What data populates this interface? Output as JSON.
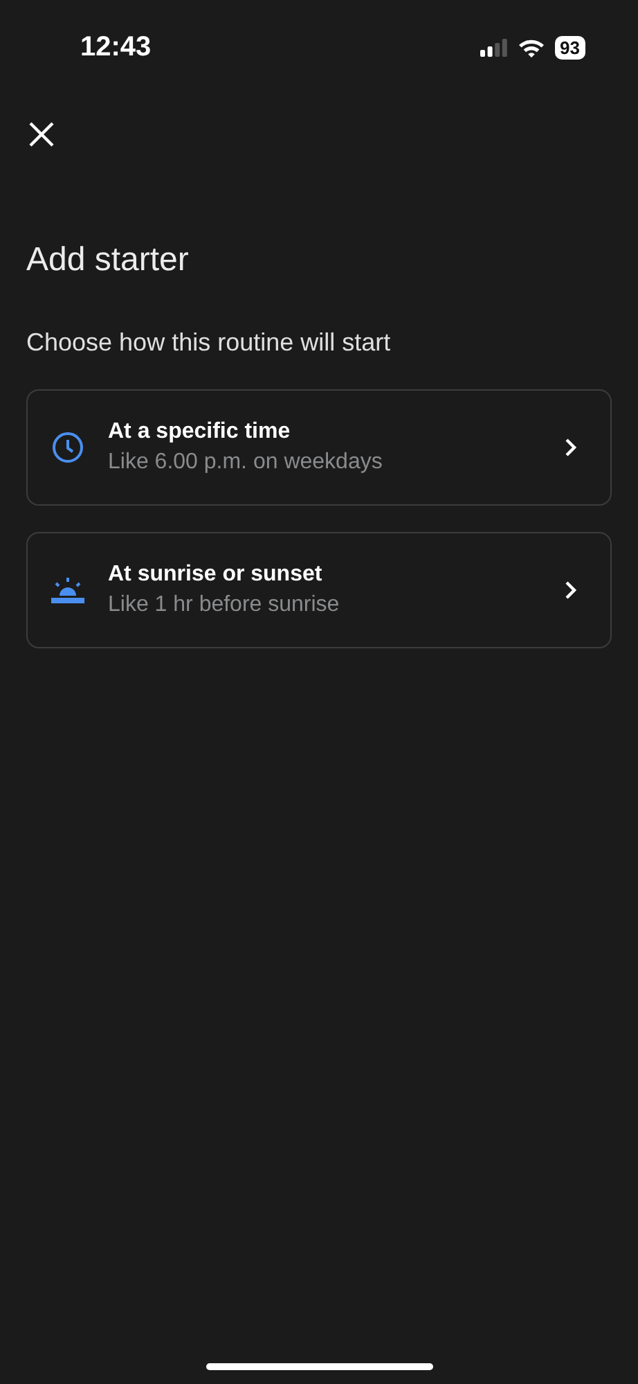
{
  "status_bar": {
    "time": "12:43",
    "battery": "93"
  },
  "title": "Add starter",
  "subtitle": "Choose how this routine will start",
  "options": [
    {
      "kind": "time",
      "title": "At a specific time",
      "description": "Like 6.00 p.m. on weekdays"
    },
    {
      "kind": "sun",
      "title": "At sunrise or sunset",
      "description": "Like 1 hr before sunrise"
    }
  ]
}
